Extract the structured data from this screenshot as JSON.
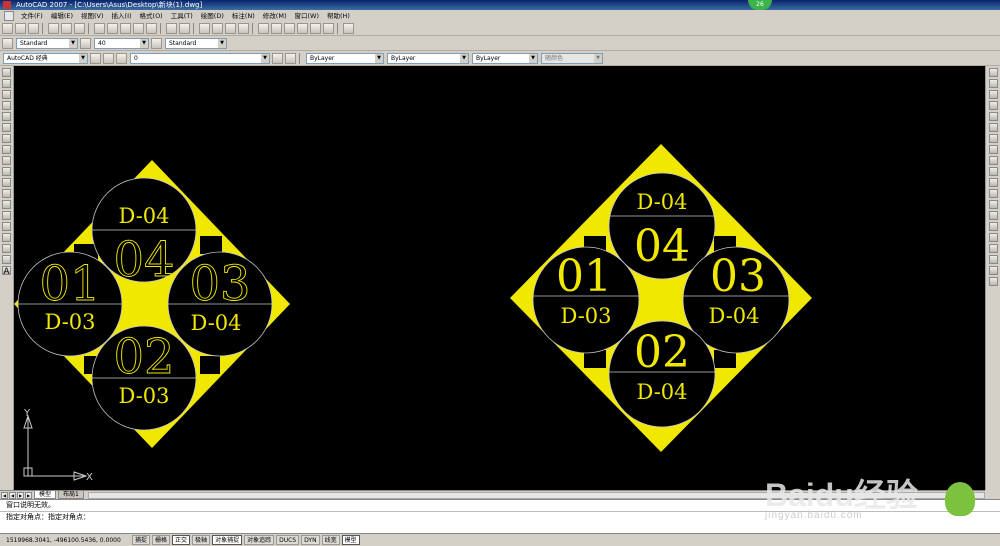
{
  "title": "AutoCAD 2007 - [C:\\Users\\Asus\\Desktop\\新块(1).dwg]",
  "badge": "26",
  "menu": [
    "文件(F)",
    "编辑(E)",
    "视图(V)",
    "插入(I)",
    "格式(O)",
    "工具(T)",
    "绘图(D)",
    "标注(N)",
    "修改(M)",
    "窗口(W)",
    "帮助(H)"
  ],
  "styles": {
    "text_style": "Standard",
    "dim_style": "40",
    "table_style": "Standard"
  },
  "workspace": "AutoCAD 经典",
  "layer": "0",
  "properties": {
    "color": "ByLayer",
    "linetype": "ByLayer",
    "lineweight": "ByLayer",
    "plotstyle": "随颜色"
  },
  "drawing": {
    "left_block": {
      "top": {
        "code": "D-04",
        "number": "04"
      },
      "left": {
        "number": "01",
        "code": "D-03"
      },
      "right": {
        "number": "03",
        "code": "D-04"
      },
      "bottom": {
        "number": "02",
        "code": "D-03"
      }
    },
    "right_block": {
      "top": {
        "code": "D-04",
        "number": "04"
      },
      "left": {
        "number": "01",
        "code": "D-03"
      },
      "right": {
        "number": "03",
        "code": "D-04"
      },
      "bottom": {
        "number": "02",
        "code": "D-04"
      }
    },
    "ucs": {
      "y_label": "Y",
      "x_label": "X"
    }
  },
  "tabs": [
    "模型",
    "布局1"
  ],
  "command_lines": [
    "窗口说明无效。",
    "指定对角点：指定对角点："
  ],
  "coordinates": "1519968.3041, -496100.5436, 0.0000",
  "status_toggles": [
    {
      "label": "捕捉",
      "on": false
    },
    {
      "label": "栅格",
      "on": false
    },
    {
      "label": "正交",
      "on": true
    },
    {
      "label": "极轴",
      "on": false
    },
    {
      "label": "对象捕捉",
      "on": true
    },
    {
      "label": "对象追踪",
      "on": false
    },
    {
      "label": "DUCS",
      "on": false
    },
    {
      "label": "DYN",
      "on": false
    },
    {
      "label": "线宽",
      "on": false
    },
    {
      "label": "模型",
      "on": true
    }
  ],
  "watermark": {
    "logo": "Baidu经验",
    "url": "jingyan.baidu.com"
  },
  "colors": {
    "accent": "#f0e800",
    "canvas": "#000000",
    "circle_stroke": "#c8c8c8"
  }
}
